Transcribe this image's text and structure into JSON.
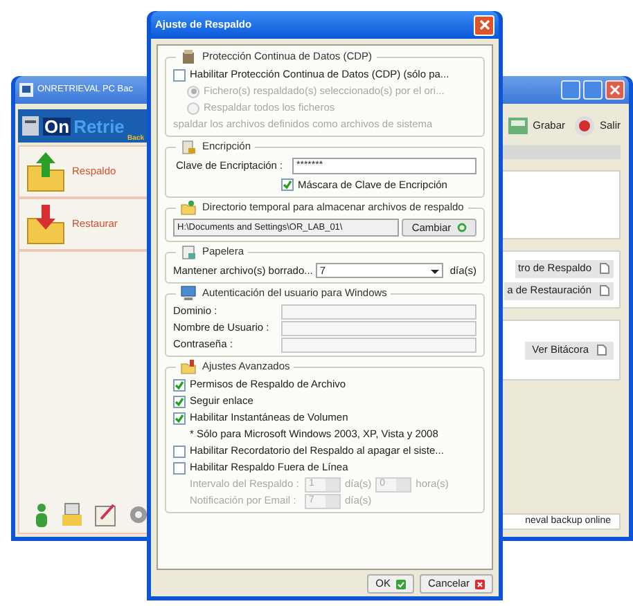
{
  "background_window": {
    "title": "ONRETRIEVAL PC Bac",
    "logo": {
      "part_1": "On",
      "part_2": "Retrie",
      "tagline": "Back"
    },
    "toolbar": [
      "Grabar",
      "Salir"
    ],
    "sidebar": {
      "items": [
        {
          "label": "Respaldo",
          "kind": "backup"
        },
        {
          "label": "Restaurar",
          "kind": "restore"
        }
      ]
    },
    "buttons": [
      "tro de Respaldo",
      "a de Restauración",
      "Ver Bitácora"
    ],
    "status": "neval backup online"
  },
  "dialog": {
    "title": "Ajuste de Respaldo",
    "cdp": {
      "title": "Protección Continua de Datos (CDP)",
      "checkbox": {
        "label": "Habilitar Protección Continua de Datos (CDP) (sólo pa...",
        "checked": false
      },
      "radios": [
        {
          "label": "Fichero(s) respaldado(s) seleccionado(s) por el ori...",
          "selected": true,
          "disabled": true
        },
        {
          "label": "Respaldar todos los ficheros",
          "selected": false,
          "disabled": true
        }
      ],
      "note": "spaldar los archivos definidos como archivos de sistema"
    },
    "encryption": {
      "title": "Encripción",
      "key_label": "Clave de Encriptación :",
      "key_value": "*******",
      "mask": {
        "label": "Máscara de Clave de Encripción",
        "checked": true
      }
    },
    "temp_dir": {
      "title": "Directorio temporal para almacenar archivos de respaldo",
      "path": "H:\\Documents and Settings\\OR_LAB_01\\",
      "button": "Cambiar"
    },
    "recycle": {
      "title": "Papelera",
      "label": "Mantener archivo(s) borrado...",
      "value": "7",
      "unit": "día(s)"
    },
    "auth": {
      "title": "Autenticación del usuario para Windows",
      "fields": [
        {
          "label": "Dominio :"
        },
        {
          "label": "Nombre de Usuario :"
        },
        {
          "label": "Contraseña :"
        }
      ]
    },
    "advanced": {
      "title": "Ajustes Avanzados",
      "items": [
        {
          "kind": "checkbox",
          "label": "Permisos de Respaldo de Archivo",
          "checked": true
        },
        {
          "kind": "checkbox",
          "label": "Seguir enlace",
          "checked": true
        },
        {
          "kind": "checkbox",
          "label": "Habilitar Instantáneas de Volumen",
          "checked": true
        },
        {
          "kind": "note",
          "label": "* Sólo para Microsoft Windows 2003, XP, Vista y 2008"
        },
        {
          "kind": "checkbox",
          "label": "Habilitar Recordatorio del Respaldo al apagar el siste...",
          "checked": false
        },
        {
          "kind": "checkbox",
          "label": "Habilitar Respaldo Fuera de Línea",
          "checked": false
        }
      ],
      "offline_rows": [
        {
          "label": "Intervalo del Respaldo :",
          "disabled": true,
          "spinners": [
            {
              "value": "1",
              "unit": "día(s)"
            },
            {
              "value": "0",
              "unit": "hora(s)"
            }
          ]
        },
        {
          "label": "Notificación por Email :",
          "disabled": true,
          "spinners": [
            {
              "value": "7",
              "unit": "día(s)"
            }
          ]
        }
      ]
    },
    "buttons": [
      {
        "label": "OK",
        "kind": "ok"
      },
      {
        "label": "Cancelar",
        "kind": "cancel"
      }
    ]
  }
}
